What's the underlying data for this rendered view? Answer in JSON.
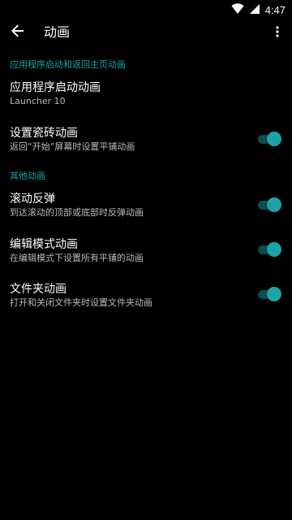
{
  "status_bar": {
    "time": "4:47",
    "icons": [
      "wifi-icon",
      "cellular-icon"
    ]
  },
  "app_bar": {
    "title": "动画",
    "back_icon": "arrow-back-icon",
    "overflow_icon": "more-vert-icon"
  },
  "colors": {
    "accent": "#1da2a9",
    "background": "#000000",
    "summary_text": "#b9b9b9"
  },
  "sections": [
    {
      "header": "应用程序启动和返回主页动画",
      "items": [
        {
          "title": "应用程序启动动画",
          "summary": "Launcher 10"
        },
        {
          "title": "设置瓷砖动画",
          "summary": "返回“开始”屏幕时设置平铺动画",
          "switch_on": true
        }
      ]
    },
    {
      "header": "其他动画",
      "items": [
        {
          "title": "滚动反弹",
          "summary": "到达滚动的顶部或底部时反弹动画",
          "switch_on": true
        },
        {
          "title": "编辑模式动画",
          "summary": "在编辑模式下设置所有平铺的动画",
          "switch_on": true
        },
        {
          "title": "文件夹动画",
          "summary": "打开和关闭文件夹时设置文件夹动画",
          "switch_on": true
        }
      ]
    }
  ]
}
